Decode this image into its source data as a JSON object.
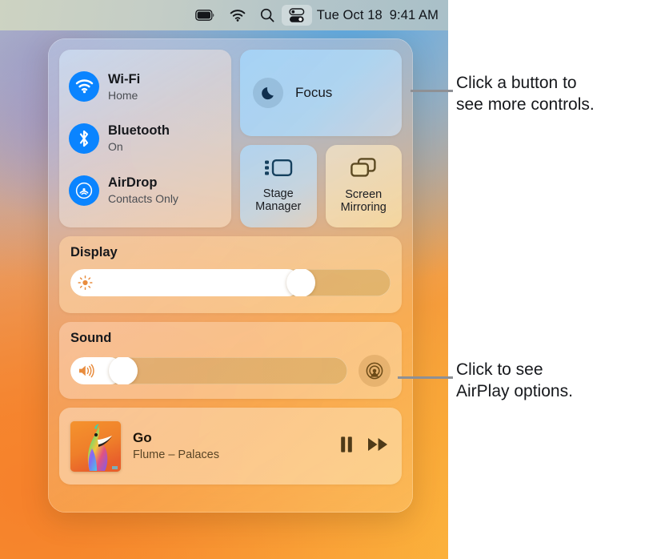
{
  "menubar": {
    "icons": [
      {
        "name": "battery-icon",
        "label": "Battery"
      },
      {
        "name": "wifi-icon",
        "label": "Wi-Fi"
      },
      {
        "name": "spotlight-search-icon",
        "label": "Spotlight Search"
      },
      {
        "name": "control-center-icon",
        "label": "Control Center"
      }
    ],
    "date": "Tue Oct 18",
    "time": "9:41 AM"
  },
  "control_center": {
    "connectivity": [
      {
        "icon": "wifi-icon",
        "title": "Wi-Fi",
        "status": "Home"
      },
      {
        "icon": "bluetooth-icon",
        "title": "Bluetooth",
        "status": "On"
      },
      {
        "icon": "airdrop-icon",
        "title": "AirDrop",
        "status": "Contacts Only"
      }
    ],
    "focus": {
      "label": "Focus",
      "icon": "moon-icon"
    },
    "stage_manager": {
      "label": "Stage\nManager",
      "icon": "stage-manager-icon"
    },
    "screen_mirroring": {
      "label": "Screen\nMirroring",
      "icon": "screen-mirroring-icon"
    },
    "display": {
      "title": "Display",
      "icon": "brightness-icon",
      "value": 72
    },
    "sound": {
      "title": "Sound",
      "icon": "volume-icon",
      "value": 19,
      "airplay_icon": "airplay-icon"
    },
    "now_playing": {
      "track": "Go",
      "artist_album": "Flume – Palaces",
      "album_art": "colorful-bird-artwork",
      "pause_icon": "pause-icon",
      "forward_icon": "fast-forward-icon"
    }
  },
  "callouts": [
    {
      "text": "Click a button to\nsee more controls."
    },
    {
      "text": "Click to see\nAirPlay options."
    }
  ],
  "colors": {
    "accent_blue": "#0a84ff",
    "leader_line": "#8e9095",
    "text_primary": "#16181c"
  }
}
